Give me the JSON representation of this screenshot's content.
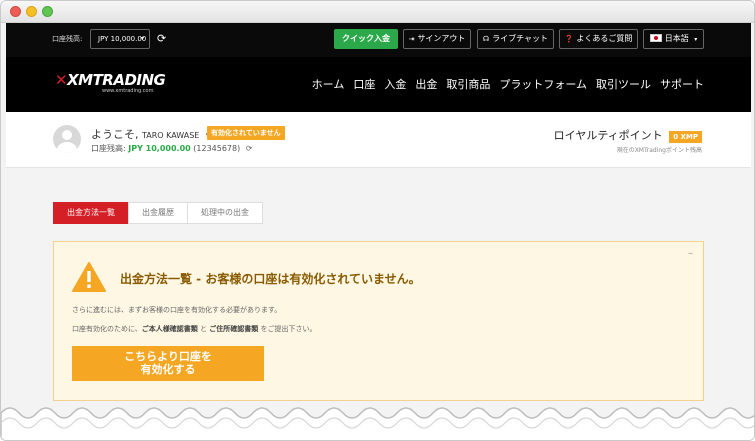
{
  "topbar": {
    "balance_label": "口座残高:",
    "balance_value": "JPY 10,000.00",
    "buttons": {
      "quick_deposit": "クイック入金",
      "signout": "サインアウト",
      "livechat": "ライブチャット",
      "faq": "よくあるご質問",
      "language": "日本語"
    }
  },
  "header": {
    "logo_text": "XMTRADING",
    "logo_url": "www.xmtrading.com",
    "nav": [
      "ホーム",
      "口座",
      "入金",
      "出金",
      "取引商品",
      "プラットフォーム",
      "取引ツール",
      "サポート"
    ]
  },
  "user": {
    "welcome": "ようこそ,",
    "name": "TARO KAWASE",
    "status_badge": "有効化されていません",
    "balance_label": "口座残高:",
    "balance_amount": "JPY 10,000.00",
    "account_id": "(12345678)",
    "loyalty_label": "ロイヤルティポイント",
    "loyalty_points": "0 XMP",
    "loyalty_sub": "現在のXMTradingポイント残高"
  },
  "tabs": [
    "出金方法一覧",
    "出金履歴",
    "処理中の出金"
  ],
  "alert": {
    "collapse": "–",
    "title": "出金方法一覧 - お客様の口座は有効化されていません。",
    "line1": "さらに進むには、まずお客様の口座を有効化する必要があります。",
    "line2_pre": "口座有効化のために、",
    "line2_doc1": "ご本人様確認書類",
    "line2_mid": " と ",
    "line2_doc2": "ご住所確認書類",
    "line2_post": " をご提出下さい。",
    "cta_line1": "こちらより口座を",
    "cta_line2": "有効化する"
  },
  "colors": {
    "brand_red": "#d51f27",
    "accent_orange": "#f5a623",
    "success_green": "#2ba94a"
  },
  "icons": {
    "refresh": "refresh-icon",
    "signout": "signout-icon",
    "headset": "headset-icon",
    "question": "question-icon",
    "flag": "japan-flag-icon",
    "warning": "warning-icon"
  }
}
